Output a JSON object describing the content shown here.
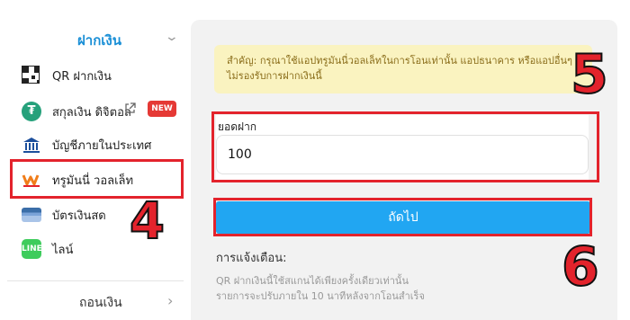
{
  "sidebar": {
    "section_title": "ฝากเงิน",
    "items": [
      {
        "label": "QR ฝากเงิน",
        "icon": "qr-code-icon"
      },
      {
        "label": "สกุลเงิน ดิจิตอล",
        "icon": "tether-icon",
        "badge": "NEW"
      },
      {
        "label": "บัญชีภายในประเทศ",
        "icon": "bank-icon"
      },
      {
        "label": "ทรูมันนี่ วอลเล็ท",
        "icon": "truemoney-icon"
      },
      {
        "label": "บัตรเงินสด",
        "icon": "cash-card-icon"
      },
      {
        "label": "ไลน์",
        "icon": "line-icon",
        "icon_text": "LINE"
      }
    ],
    "withdraw_label": "ถอนเงิน"
  },
  "main": {
    "notice": "สำคัญ: กรุณาใช้แอปทรูมันนี่วอลเล็ทในการโอนเท่านั้น แอปธนาคาร หรือแอปอื่นๆ ไม่รองรับการฝากเงินนี้",
    "amount_label": "ยอดฝาก",
    "amount_value": "100",
    "next_label": "ถัดไป",
    "warning_title": "การแจ้งเตือน:",
    "warning_lines": [
      "QR ฝากเงินนี้ใช้สแกนได้เพียงครั้งเดียวเท่านั้น",
      "รายการจะปรับภายใน 10 นาทีหลังจากโอนสำเร็จ"
    ]
  },
  "annotations": {
    "step4": "4",
    "step5": "5",
    "step6": "6"
  },
  "colors": {
    "accent": "#21a6f2",
    "highlight": "#e3232c",
    "notice_bg": "#faf3c0"
  }
}
